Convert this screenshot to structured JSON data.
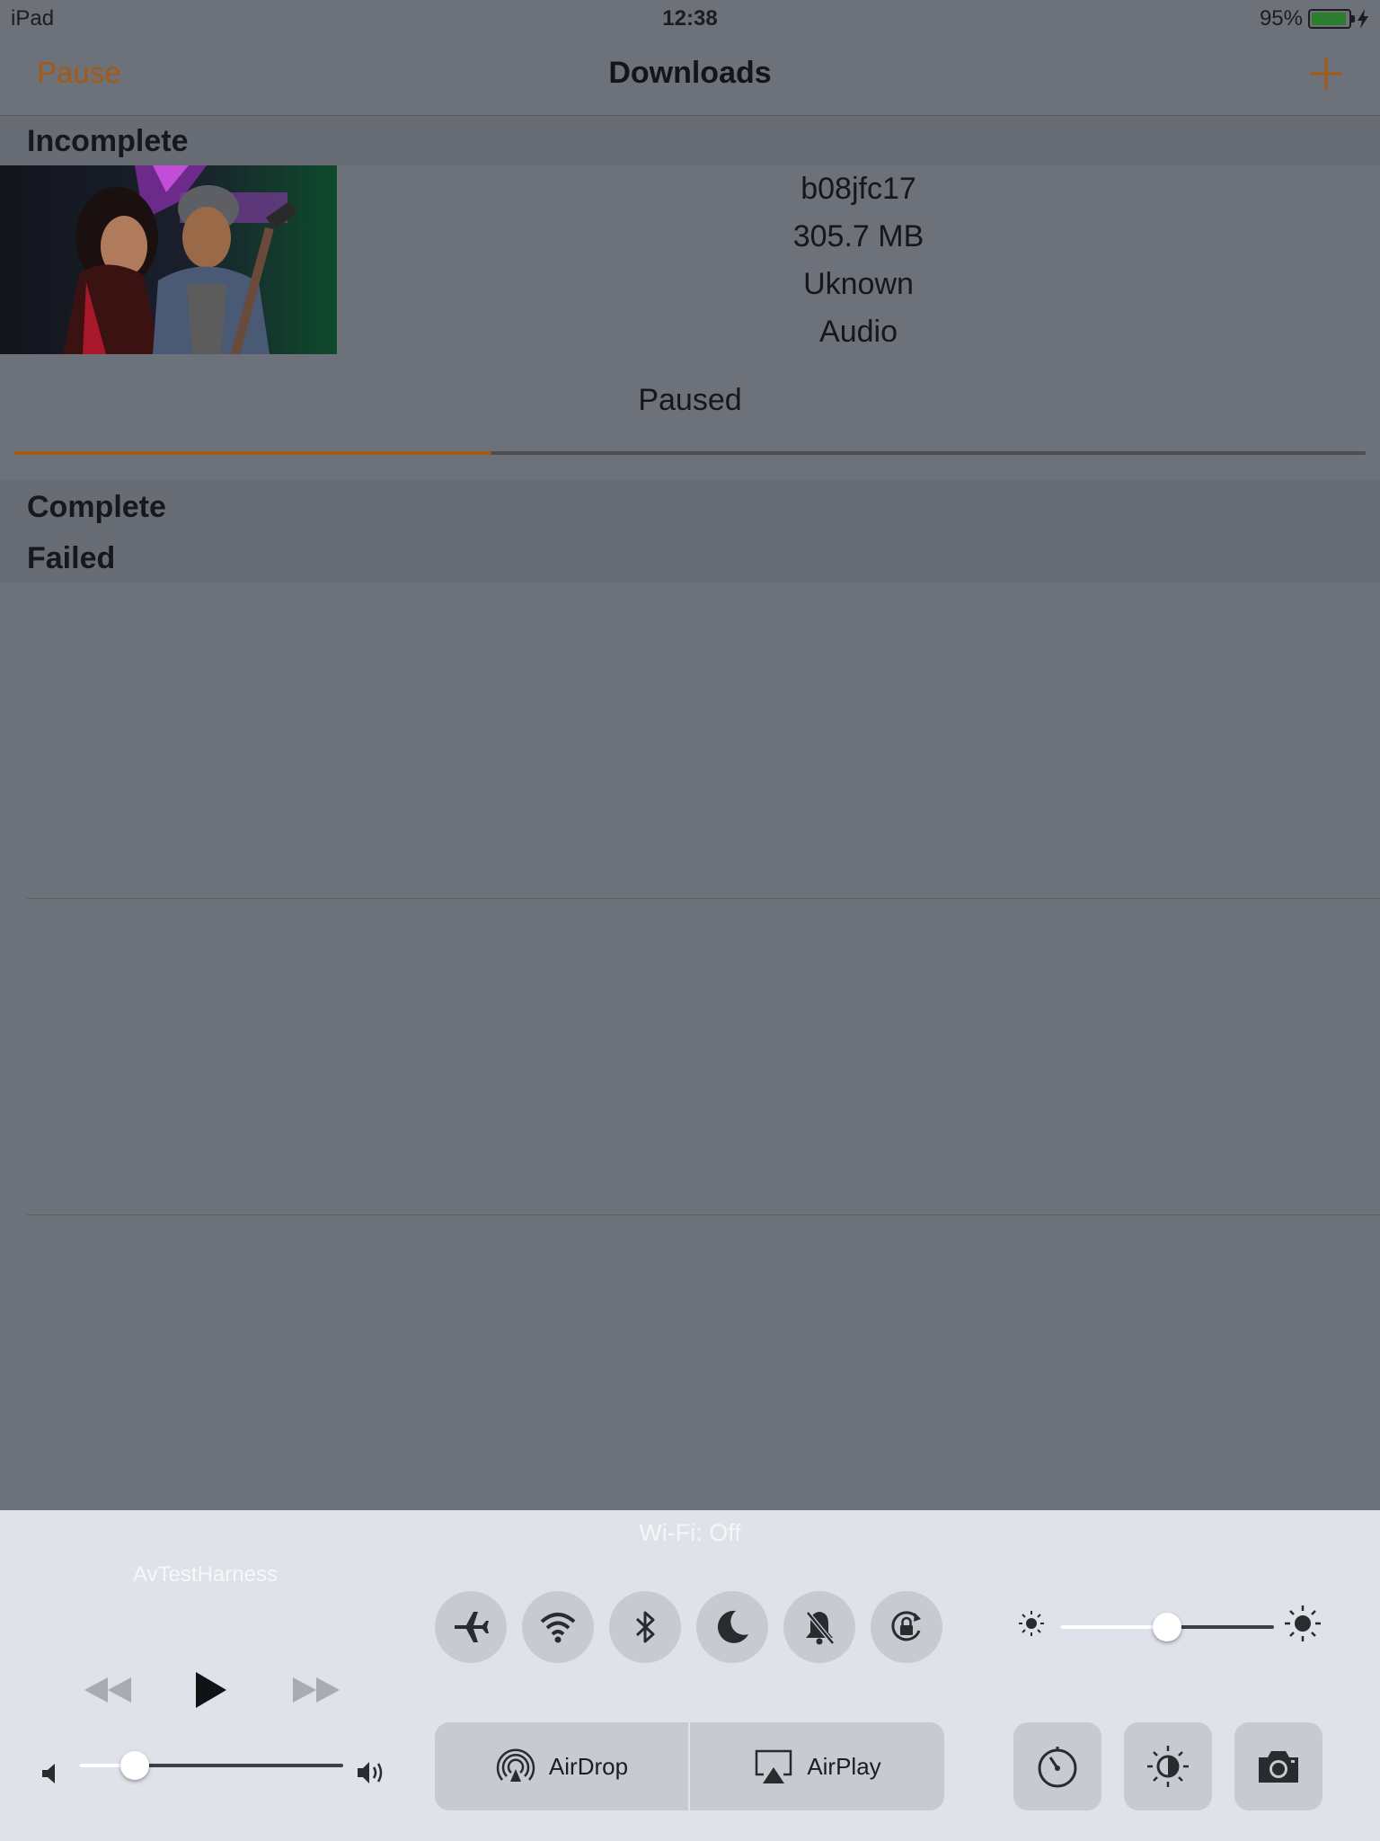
{
  "status_bar": {
    "device": "iPad",
    "time": "12:38",
    "battery": "95%",
    "battery_level": 0.95
  },
  "nav": {
    "left_button": "Pause",
    "title": "Downloads",
    "right_icon": "plus-icon"
  },
  "sections": {
    "incomplete": "Incomplete",
    "complete": "Complete",
    "failed": "Failed"
  },
  "download": {
    "name": "b08jfc17",
    "size": "305.7 MB",
    "duration": "Uknown",
    "type": "Audio",
    "status": "Paused",
    "progress": 0.353
  },
  "control_center": {
    "wifi_status": "Wi-Fi: Off",
    "now_playing_app": "AvTestHarness",
    "toggles": [
      "airplane-icon",
      "wifi-icon",
      "bluetooth-icon",
      "moon-icon",
      "mute-bell-icon",
      "rotation-lock-icon"
    ],
    "brightness_level": 0.5,
    "volume_level": 0.21,
    "airdrop_label": "AirDrop",
    "airplay_label": "AirPlay",
    "shortcuts": [
      "timer-icon",
      "night-shift-icon",
      "camera-icon"
    ],
    "colors": {
      "accent": "#a55a14"
    }
  }
}
